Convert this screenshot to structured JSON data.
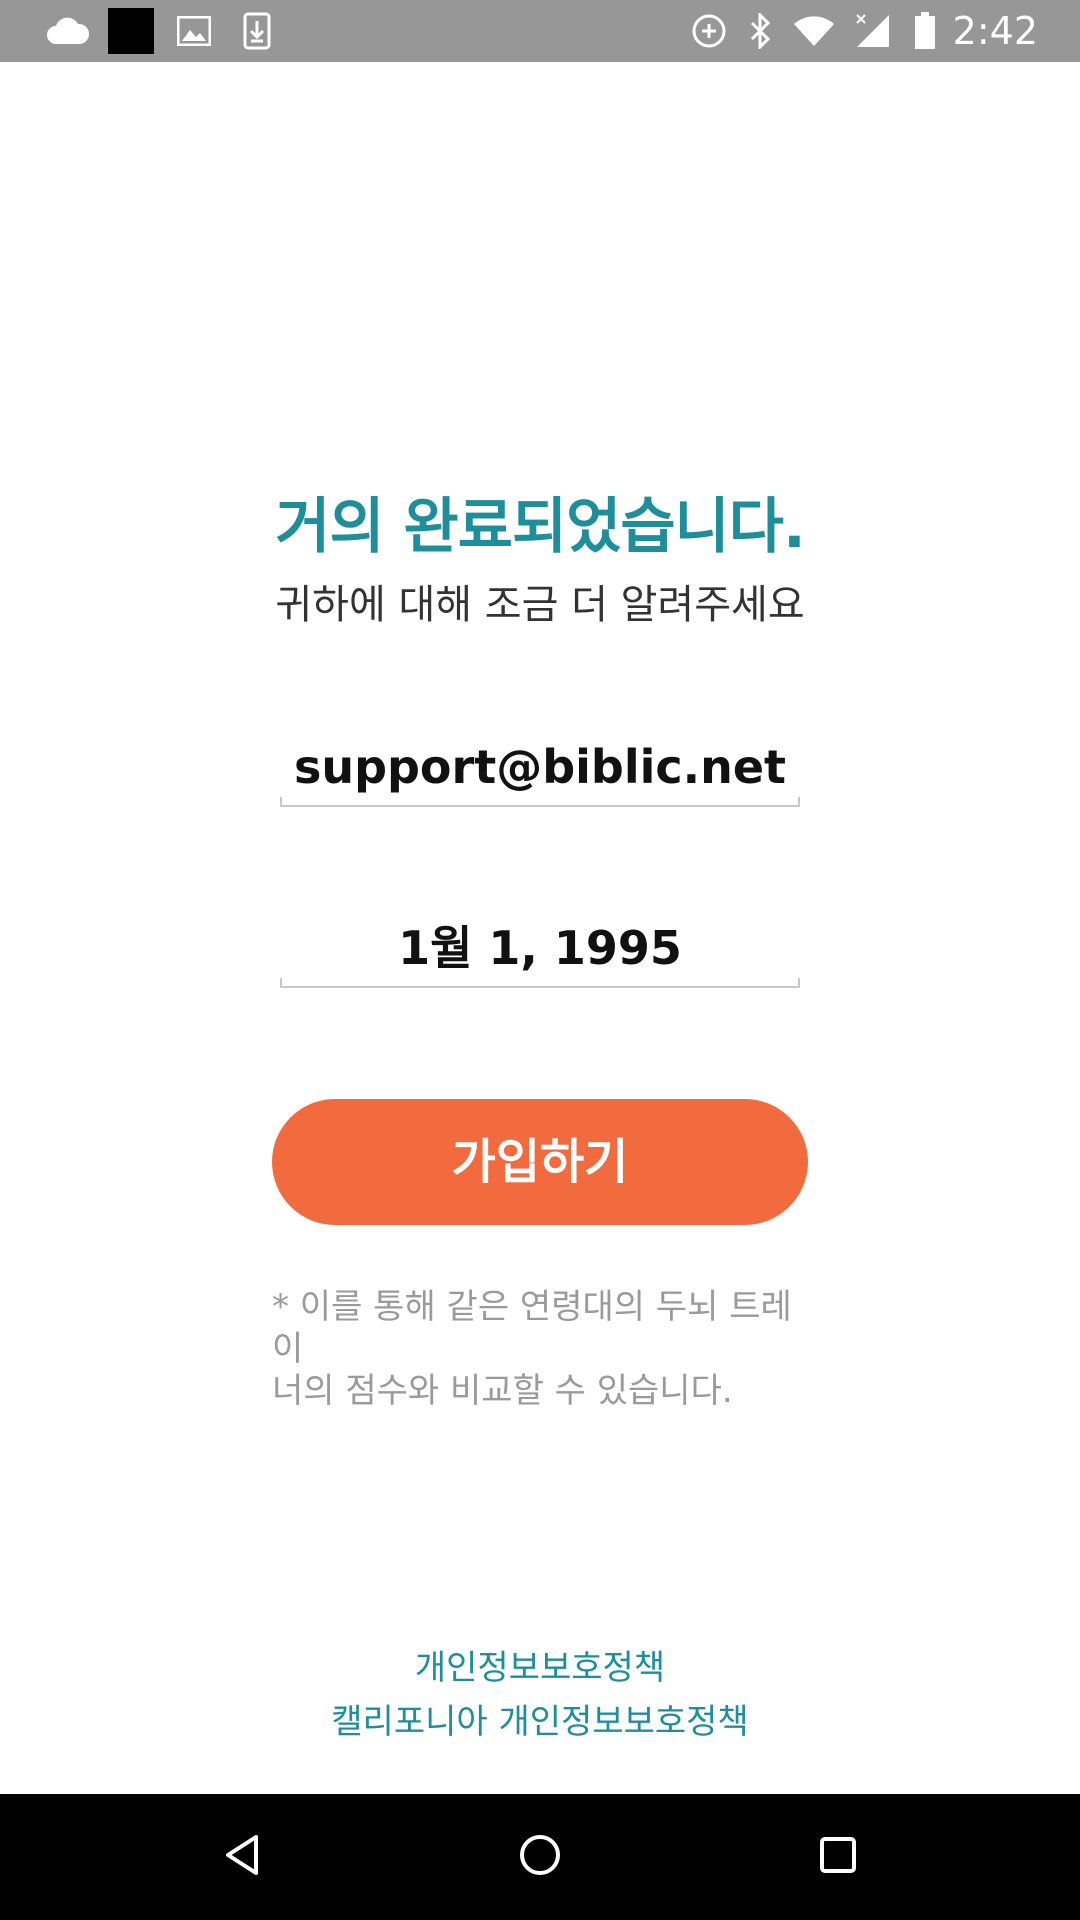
{
  "status_bar": {
    "time": "2:42",
    "left_icons": [
      "cloud-icon",
      "black-square-icon",
      "image-icon",
      "download-icon"
    ],
    "right_icons": [
      "data-saver-icon",
      "bluetooth-icon",
      "wifi-icon",
      "signal-icon",
      "battery-icon"
    ]
  },
  "main": {
    "title": "거의 완료되었습니다.",
    "subtitle": "귀하에 대해 조금 더 알려주세요",
    "email_value": "support@biblic.net",
    "birthdate_value": "1월 1, 1995",
    "signup_button_label": "가입하기",
    "note_line1": "* 이를 통해 같은 연령대의 두뇌 트레이",
    "note_line2": "너의 점수와 비교할 수 있습니다."
  },
  "footer": {
    "privacy_policy": "개인정보보호정책",
    "california_privacy_policy": "캘리포니아 개인정보보호정책"
  },
  "nav_bar": {
    "buttons": [
      "back-icon",
      "home-icon",
      "recents-icon"
    ]
  },
  "colors": {
    "accent_teal": "#1e8e9a",
    "button_orange": "#f26b3f",
    "status_bar_gray": "#979797",
    "nav_bar_black": "#000000"
  }
}
